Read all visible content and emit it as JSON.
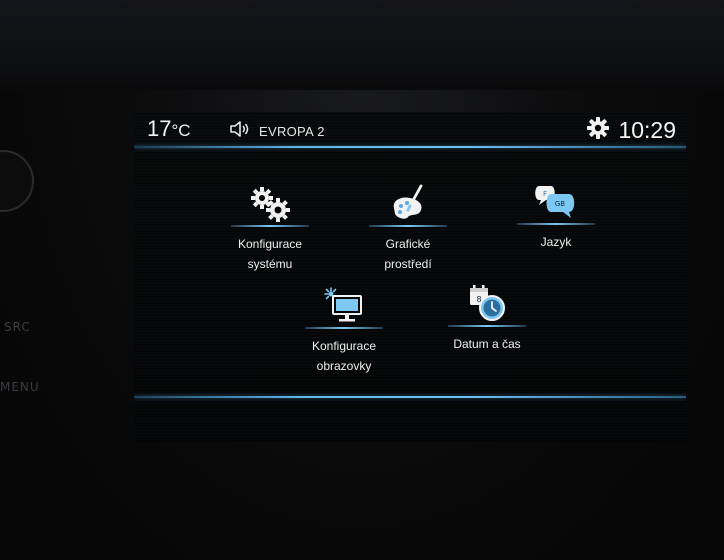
{
  "status_bar": {
    "temperature_value": "17",
    "temperature_unit": "°C",
    "radio_station": "EVROPA 2",
    "time": "10:29"
  },
  "side_panel": {
    "src_label": "SRC",
    "menu_label": "MENU"
  },
  "menu": {
    "system_config": {
      "line1": "Konfigurace",
      "line2": "systému",
      "icon": "gears-icon"
    },
    "graphics": {
      "line1": "Grafické",
      "line2": "prostředí",
      "icon": "palette-brush-icon"
    },
    "language": {
      "line1": "Jazyk",
      "icon": "speech-bubbles-icon",
      "bubble_a": "F",
      "bubble_b": "GB"
    },
    "screen_config": {
      "line1": "Konfigurace",
      "line2": "obrazovky",
      "icon": "monitor-brightness-icon"
    },
    "date_time": {
      "line1": "Datum a čas",
      "icon": "calendar-clock-icon",
      "calendar_glyph": "8"
    }
  },
  "colors": {
    "accent_blue": "#6ec2f5",
    "icon_white": "#f2f2f2",
    "icon_blue": "#7cc8f2",
    "background": "#040506"
  }
}
